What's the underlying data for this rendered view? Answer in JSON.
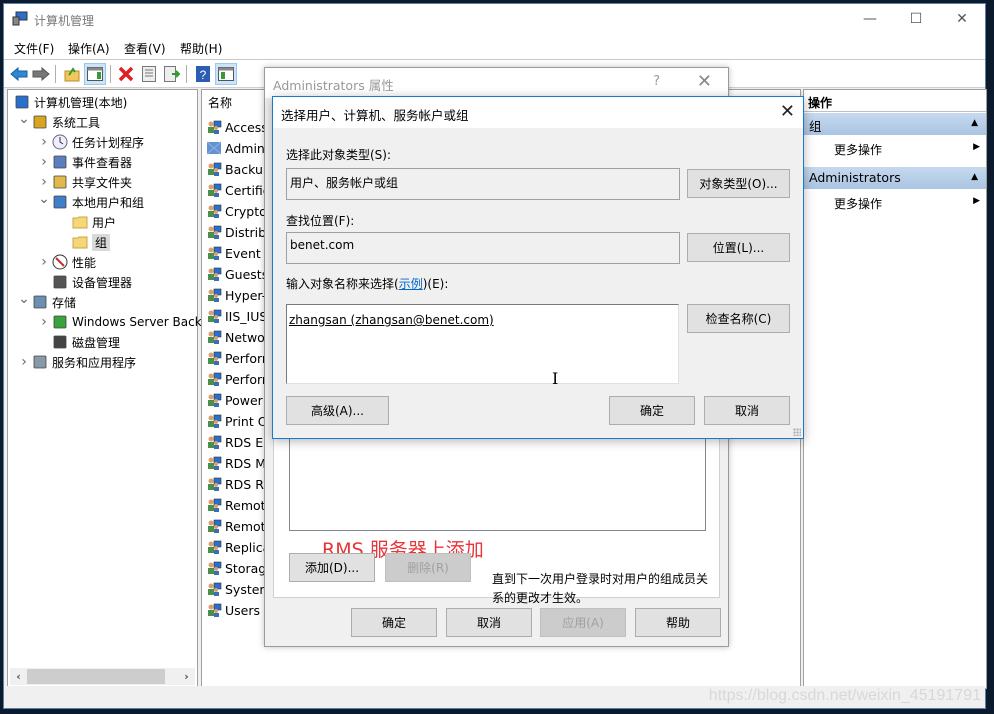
{
  "window": {
    "title": "计算机管理",
    "controls": {
      "minimize": "—",
      "maximize": "☐",
      "close": "✕"
    }
  },
  "menu": [
    "文件(F)",
    "操作(A)",
    "查看(V)",
    "帮助(H)"
  ],
  "toolbar": {
    "icons": [
      "back-arrow-icon",
      "forward-arrow-icon",
      "up-folder-icon",
      "show-hide-tree-icon",
      "delete-icon",
      "properties-icon",
      "export-list-icon",
      "help-icon",
      "show-hide-action-pane-icon"
    ]
  },
  "tree": {
    "items": [
      {
        "label": "计算机管理(本地)",
        "level": 0,
        "expander": "",
        "icon": "computer-management-icon"
      },
      {
        "label": "系统工具",
        "level": 1,
        "expander": "expanded",
        "icon": "tools-icon"
      },
      {
        "label": "任务计划程序",
        "level": 2,
        "expander": "collapsed",
        "icon": "clock-icon"
      },
      {
        "label": "事件查看器",
        "level": 2,
        "expander": "collapsed",
        "icon": "event-viewer-icon"
      },
      {
        "label": "共享文件夹",
        "level": 2,
        "expander": "collapsed",
        "icon": "shared-folder-icon"
      },
      {
        "label": "本地用户和组",
        "level": 2,
        "expander": "expanded",
        "icon": "users-groups-icon"
      },
      {
        "label": "用户",
        "level": 3,
        "expander": "",
        "icon": "folder-icon"
      },
      {
        "label": "组",
        "level": 3,
        "expander": "",
        "icon": "folder-icon",
        "selected": true
      },
      {
        "label": "性能",
        "level": 2,
        "expander": "collapsed",
        "icon": "performance-icon"
      },
      {
        "label": "设备管理器",
        "level": 2,
        "expander": "",
        "icon": "device-manager-icon"
      },
      {
        "label": "存储",
        "level": 1,
        "expander": "expanded",
        "icon": "storage-icon"
      },
      {
        "label": "Windows Server Back",
        "level": 2,
        "expander": "collapsed",
        "icon": "backup-icon"
      },
      {
        "label": "磁盘管理",
        "level": 2,
        "expander": "",
        "icon": "disk-icon"
      },
      {
        "label": "服务和应用程序",
        "level": 1,
        "expander": "collapsed",
        "icon": "services-icon"
      }
    ]
  },
  "list": {
    "header": "名称",
    "items": [
      "Access",
      "Adminis",
      "Backup",
      "Certifica",
      "Cryptog",
      "Distribu",
      "Event Lo",
      "Guests",
      "Hyper-V",
      "IIS_IUSR",
      "Networ",
      "Perform",
      "Perform",
      "Power U",
      "Print Op",
      "RDS End",
      "RDS Ma",
      "RDS Re",
      "Remote",
      "Remote",
      "Replicat",
      "Storage",
      "System",
      "Users"
    ]
  },
  "actions": {
    "title": "操作",
    "groups": [
      {
        "label": "组",
        "item": "更多操作"
      },
      {
        "label": "Administrators",
        "item": "更多操作"
      }
    ]
  },
  "properties_dialog": {
    "title": "Administrators 属性",
    "help": "?",
    "close": "✕",
    "annotation": "RMS 服务器上添加",
    "add_button": "添加(D)...",
    "remove_button": "删除(R)",
    "note": "直到下一次用户登录时对用户的组成员关系的更改才生效。",
    "ok": "确定",
    "cancel": "取消",
    "apply": "应用(A)",
    "help_button": "帮助"
  },
  "select_dialog": {
    "title": "选择用户、计算机、服务帐户或组",
    "close": "✕",
    "object_type_label": "选择此对象类型(S):",
    "object_type_value": "用户、服务帐户或组",
    "object_type_button": "对象类型(O)...",
    "location_label": "查找位置(F):",
    "location_value": "benet.com",
    "location_button": "位置(L)...",
    "enter_label_prefix": "输入对象名称来选择(",
    "enter_label_link": "示例",
    "enter_label_suffix": ")(E):",
    "entered_name": "zhangsan (zhangsan@benet.com)",
    "check_names_button": "检查名称(C)",
    "advanced_button": "高级(A)...",
    "ok": "确定",
    "cancel": "取消"
  },
  "watermark": "https://blog.csdn.net/weixin_45191791"
}
